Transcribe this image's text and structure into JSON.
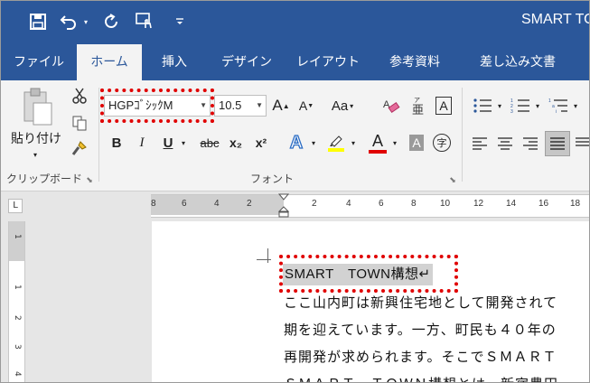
{
  "window": {
    "title": "SMART TO"
  },
  "quick_access": {
    "save_icon": "save-icon",
    "undo_icon": "undo-icon",
    "redo_icon": "redo-icon",
    "touch_icon": "touch-mode-icon",
    "customize_icon": "customize-icon"
  },
  "tabs": [
    {
      "label": "ファイル"
    },
    {
      "label": "ホーム"
    },
    {
      "label": "挿入"
    },
    {
      "label": "デザイン"
    },
    {
      "label": "レイアウト"
    },
    {
      "label": "参考資料"
    },
    {
      "label": "差し込み文書"
    }
  ],
  "clipboard": {
    "paste_label": "貼り付け",
    "group_label": "クリップボード"
  },
  "font": {
    "font_name": "HGPｺﾞｼｯｸM",
    "font_size": "10.5",
    "group_label": "フォント",
    "bold": "B",
    "italic": "I",
    "underline": "U",
    "strike": "abc",
    "subscript": "x₂",
    "superscript": "x²",
    "change_case": "Aa",
    "grow": "A",
    "shrink": "A",
    "font_color": "A",
    "char_shading": "A",
    "char_border": "A",
    "enclose": "字",
    "effects": "A"
  },
  "ruler": {
    "ticks_left": [
      "8",
      "6",
      "4",
      "2"
    ],
    "ticks_right": [
      "2",
      "4",
      "6",
      "8",
      "10",
      "12",
      "14",
      "16",
      "18"
    ],
    "tab_selector": "L",
    "vertical_ticks": [
      "1",
      "1",
      "2",
      "3",
      "4"
    ]
  },
  "document": {
    "heading": "SMART　TOWN構想↵",
    "lines": [
      "ここ山内町は新興住宅地として開発されて",
      "期を迎えています。一方、町民も４０年の",
      "再開発が求められます。そこでＳＭＡＲＴ",
      "ＳＭＡＲＴ　ＴＯＷＮ構想とは、新宿豊田"
    ]
  },
  "colors": {
    "accent": "#2b579a",
    "highlight_box": "#e00000",
    "font_color_bar": "#e00000",
    "highlight_bar": "#ffff00"
  }
}
